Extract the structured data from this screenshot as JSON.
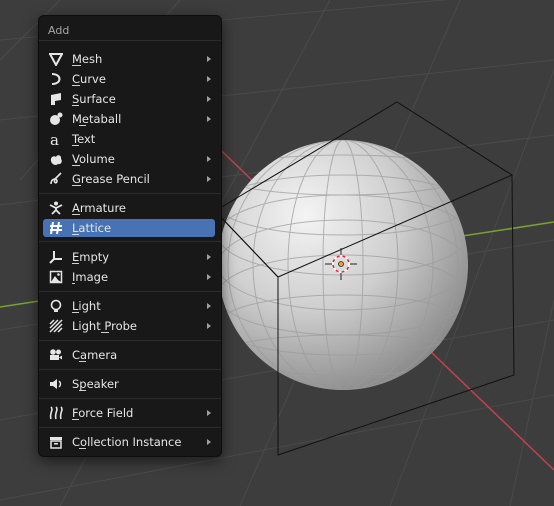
{
  "menu": {
    "title": "Add",
    "items": [
      {
        "label": "Mesh",
        "icon": "mesh-icon",
        "submenu": true
      },
      {
        "label": "Curve",
        "icon": "curve-icon",
        "submenu": true
      },
      {
        "label": "Surface",
        "icon": "surface-icon",
        "submenu": true
      },
      {
        "label": "Metaball",
        "icon": "metaball-icon",
        "submenu": true
      },
      {
        "label": "Text",
        "icon": "text-icon",
        "submenu": false
      },
      {
        "label": "Volume",
        "icon": "volume-icon",
        "submenu": true
      },
      {
        "label": "Grease Pencil",
        "icon": "grease-pencil-icon",
        "submenu": true
      },
      {
        "label": "Armature",
        "icon": "armature-icon",
        "submenu": false
      },
      {
        "label": "Lattice",
        "icon": "lattice-icon",
        "submenu": false,
        "active": true
      },
      {
        "label": "Empty",
        "icon": "empty-icon",
        "submenu": true
      },
      {
        "label": "Image",
        "icon": "image-icon",
        "submenu": true
      },
      {
        "label": "Light",
        "icon": "light-icon",
        "submenu": true
      },
      {
        "label": "Light Probe",
        "icon": "light-probe-icon",
        "submenu": true
      },
      {
        "label": "Camera",
        "icon": "camera-icon",
        "submenu": false
      },
      {
        "label": "Speaker",
        "icon": "speaker-icon",
        "submenu": false
      },
      {
        "label": "Force Field",
        "icon": "force-field-icon",
        "submenu": true
      },
      {
        "label": "Collection Instance",
        "icon": "collection-instance-icon",
        "submenu": true
      }
    ]
  },
  "colors": {
    "viewport_bg": "#3d3d3d",
    "menu_bg": "#181818",
    "highlight": "#4772b3",
    "x_axis": "#c1424e",
    "y_axis": "#7aa332"
  }
}
